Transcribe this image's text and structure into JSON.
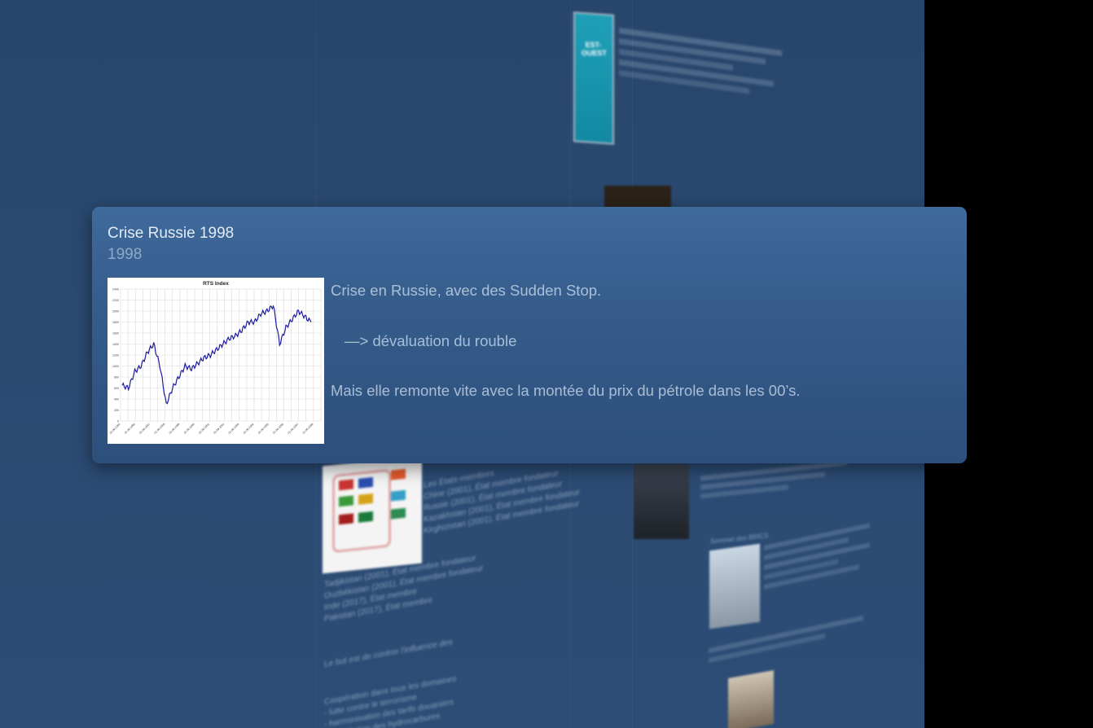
{
  "popup": {
    "title": "Crise Russie 1998",
    "year": "1998",
    "paragraph1": "Crise en Russie, avec des Sudden Stop.",
    "paragraph2": "—> dévaluation du rouble",
    "paragraph3": "Mais elle remonte vite avec la montée du prix du pétrole dans les 00’s."
  },
  "background": {
    "members_heading": "Les États-membres",
    "members": [
      "Chine (2001), État membre fondateur",
      "Russie (2001), État membre fondateur",
      "Kazakhstan (2001), État membre fondateur",
      "Kirghizistan (2001), État membre fondateur",
      "Tadjikistan (2001), État membre fondateur",
      "Ouzbékistan (2001), État membre fondateur",
      "Inde (2017), État membre",
      "Pakistan (2017), État membre"
    ],
    "influence_line": "Le but est de contrer l'influence des",
    "cooperation_lines": [
      "Coopération dans tous les domaines",
      "- lutte contre le terrorisme",
      "- harmonisation des tarifs douaniers",
      "- exploitation des hydrocarbures"
    ],
    "cover_brand": "EST-OUEST",
    "brics_heading": "Sommet des BRICS"
  },
  "chart_data": {
    "type": "line",
    "title": "RTS Index",
    "xlabel": "",
    "ylabel": "",
    "ylim": [
      0,
      2400
    ],
    "y_ticks": [
      "0",
      "200",
      "400",
      "600",
      "800",
      "1000",
      "1200",
      "1400",
      "1600",
      "1800",
      "2000",
      "2200",
      "2400"
    ],
    "x": [
      "01.09.1995",
      "01.03.1996",
      "01.09.1996",
      "01.03.1997",
      "01.09.1997",
      "01.03.1998",
      "01.09.1998",
      "01.03.1999",
      "01.09.1999",
      "01.03.2000",
      "01.09.2000",
      "01.03.2001",
      "01.09.2001",
      "01.03.2002",
      "01.09.2002",
      "01.03.2003",
      "01.09.2003",
      "01.03.2004",
      "01.09.2004",
      "01.03.2005",
      "01.09.2005",
      "01.03.2006",
      "01.09.2006",
      "01.03.2007",
      "01.09.2007",
      "01.03.2008",
      "01.09.2008",
      "01.03.2009"
    ],
    "series": [
      {
        "color": "#1a1aa0",
        "values": [
          650,
          600,
          900,
          1000,
          1250,
          1400,
          1000,
          300,
          600,
          800,
          1000,
          950,
          1050,
          1150,
          1200,
          1300,
          1400,
          1500,
          1550,
          1650,
          1800,
          1800,
          1950,
          2000,
          2100,
          1400,
          1700,
          1850,
          2000,
          1900,
          1800
        ]
      }
    ]
  }
}
